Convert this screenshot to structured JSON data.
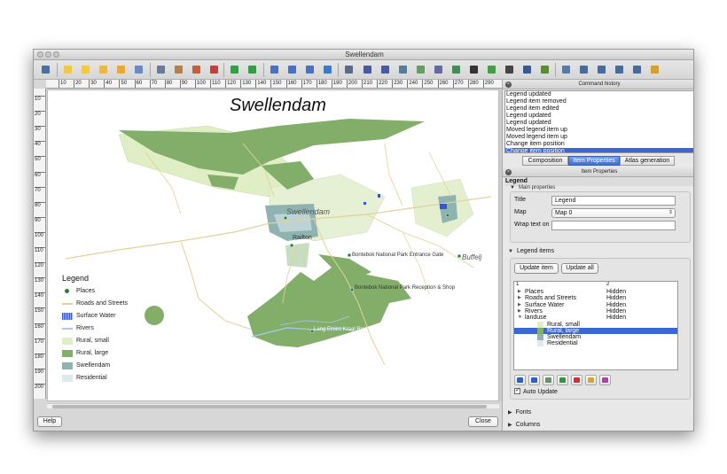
{
  "window": {
    "title": "Swellendam"
  },
  "toolbar": {
    "icons": [
      "save-icon",
      "new-composer-icon",
      "duplicate-composer-icon",
      "composer-manager-icon",
      "open-template-icon",
      "save-template-icon",
      "print-icon",
      "export-image-icon",
      "export-svg-icon",
      "export-pdf-icon",
      "undo-icon",
      "redo-icon",
      "zoom-full-icon",
      "zoom-in-icon",
      "zoom-out-icon",
      "refresh-icon",
      "pan-icon",
      "select-move-icon",
      "move-content-icon",
      "add-map-icon",
      "add-image-icon",
      "add-label-icon",
      "add-legend-icon",
      "add-scalebar-icon",
      "add-shape-icon",
      "add-arrow-icon",
      "add-table-icon",
      "add-html-icon",
      "atlas-preview-icon",
      "atlas-first-icon",
      "atlas-prev-icon",
      "atlas-next-icon",
      "atlas-last-icon",
      "atlas-print-icon"
    ]
  },
  "rulers": {
    "top": [
      "10",
      "20",
      "30",
      "40",
      "50",
      "60",
      "70",
      "80",
      "90",
      "100",
      "110",
      "120",
      "130",
      "140",
      "150",
      "160",
      "170",
      "180",
      "190",
      "200",
      "210",
      "220",
      "230",
      "240",
      "250",
      "260",
      "270",
      "280",
      "290"
    ],
    "left": [
      "10",
      "20",
      "30",
      "40",
      "50",
      "60",
      "70",
      "80",
      "90",
      "100",
      "110",
      "120",
      "130",
      "140",
      "150",
      "160",
      "170",
      "180",
      "190",
      "200"
    ]
  },
  "map": {
    "title": "Swellendam",
    "labels": {
      "swellendam": "Swellendam",
      "railton": "Railton",
      "entrance_gate": "Bontebok National Park Entrance Gate",
      "reception": "Bontebok National Park Reception & Shop",
      "buffeljags": "Buffelj",
      "camp": "Lang Elsies Kraal Rest Camp"
    },
    "legend": {
      "title": "Legend",
      "items": [
        {
          "label": "Places",
          "symbol": "point",
          "color": "#2f7d3a"
        },
        {
          "label": "Roads and Streets",
          "symbol": "line",
          "color": "#e0d29a"
        },
        {
          "label": "Surface Water",
          "symbol": "hatch",
          "color": "#3a55c8"
        },
        {
          "label": "Rivers",
          "symbol": "line",
          "color": "#aac8ee"
        },
        {
          "label": "Rural, small",
          "symbol": "fill",
          "color": "#dfeec5"
        },
        {
          "label": "Rural, large",
          "symbol": "fill",
          "color": "#82ae6a"
        },
        {
          "label": "Swellendam",
          "symbol": "fill",
          "color": "#8fb3b0"
        },
        {
          "label": "Residential",
          "symbol": "fill",
          "color": "#dde8ef"
        }
      ]
    }
  },
  "buttons": {
    "help": "Help",
    "close": "Close"
  },
  "command_history": {
    "title": "Command history",
    "items": [
      "Legend updated",
      "Legend item removed",
      "Legend item edited",
      "Legend updated",
      "Legend updated",
      "Moved legend item up",
      "Moved legend item up",
      "Change item position",
      "Change item position"
    ],
    "selected_index": 8
  },
  "tabs": [
    "Composition",
    "Item Properties",
    "Atlas generation"
  ],
  "active_tab": "Item Properties",
  "item_properties": {
    "title": "Item Properties",
    "section": "Legend",
    "main_properties": "Main properties",
    "title_label": "Title",
    "title_value": "Legend",
    "map_label": "Map",
    "map_value": "Map 0",
    "wrap_label": "Wrap text on",
    "wrap_value": ""
  },
  "legend_items": {
    "title": "Legend items",
    "update_item": "Update item",
    "update_all": "Update all",
    "col1": "1",
    "col2": "2",
    "rows": [
      {
        "name": "Places",
        "state": "Hidden",
        "type": "group"
      },
      {
        "name": "Roads and Streets",
        "state": "Hidden",
        "type": "group"
      },
      {
        "name": "Surface Water",
        "state": "Hidden",
        "type": "group"
      },
      {
        "name": "Rivers",
        "state": "Hidden",
        "type": "group"
      },
      {
        "name": "landuse",
        "state": "Hidden",
        "type": "open"
      },
      {
        "name": "Rural, small",
        "state": "",
        "type": "child",
        "color": "#dfeec5"
      },
      {
        "name": "Rural, large",
        "state": "",
        "type": "child",
        "color": "#82ae6a",
        "selected": true
      },
      {
        "name": "Swellendam",
        "state": "",
        "type": "child",
        "color": "#8fb3b0"
      },
      {
        "name": "Residential",
        "state": "",
        "type": "child",
        "color": "#dde8ef"
      }
    ],
    "tools": [
      {
        "name": "move-down-icon",
        "color": "#2a5fcf"
      },
      {
        "name": "move-up-icon",
        "color": "#2a5fcf"
      },
      {
        "name": "edit-group-icon",
        "color": "#6a8f6a"
      },
      {
        "name": "add-item-icon",
        "color": "#2a9a3a"
      },
      {
        "name": "remove-item-icon",
        "color": "#d03030"
      },
      {
        "name": "edit-item-icon",
        "color": "#e0a030"
      },
      {
        "name": "count-icon",
        "color": "#b040b0"
      }
    ],
    "auto_update": "Auto Update"
  },
  "sections": {
    "fonts": "Fonts",
    "columns": "Columns"
  }
}
